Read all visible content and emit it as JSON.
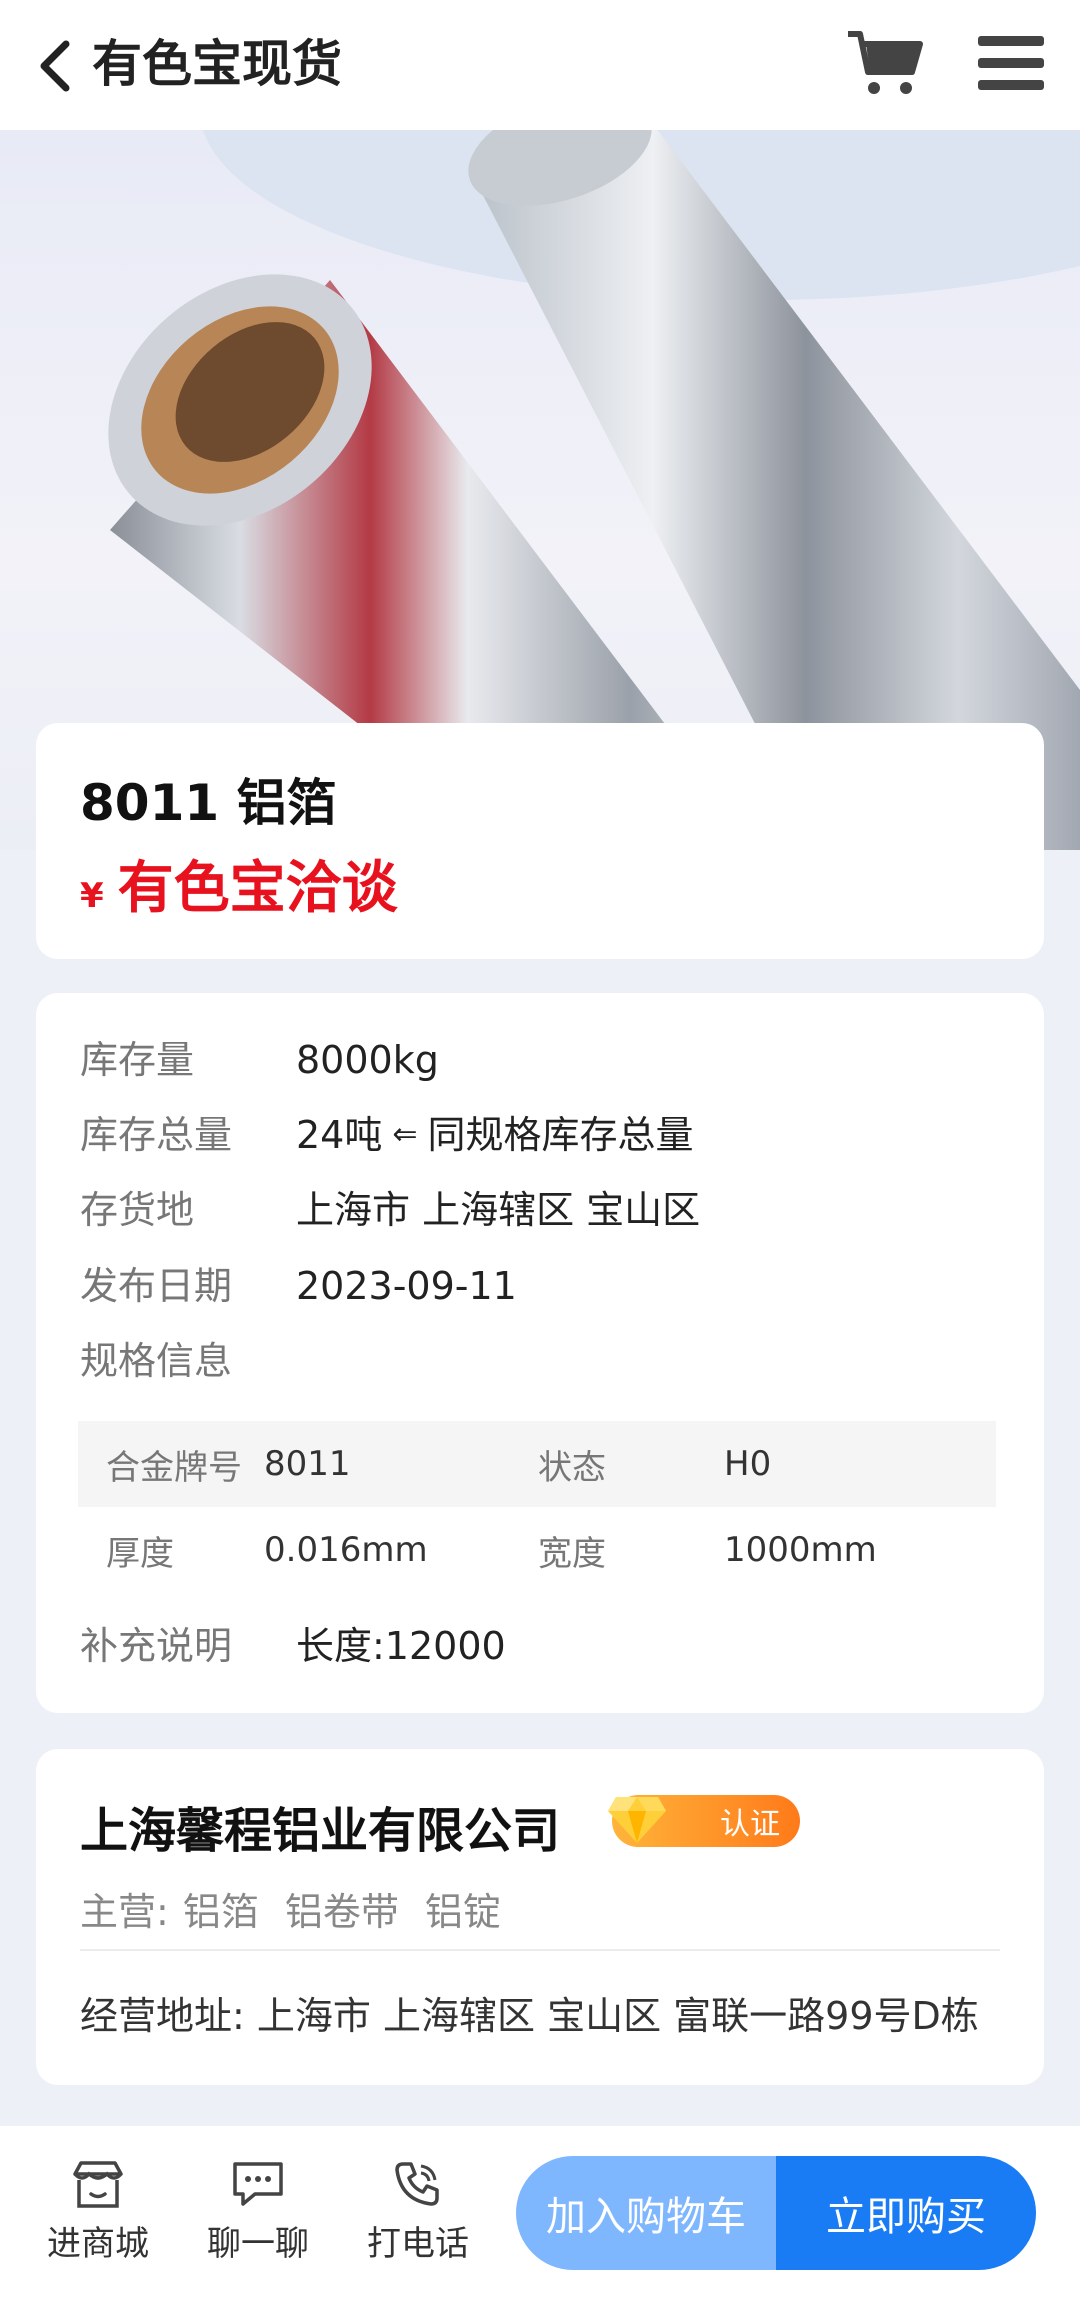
{
  "header": {
    "title": "有色宝现货",
    "back_icon": "chevron-left-icon",
    "cart_icon": "cart-icon",
    "menu_icon": "menu-icon"
  },
  "product": {
    "name": "8011 铝箔",
    "price_symbol": "¥",
    "price_text": "有色宝洽谈",
    "price_color": "#e8121f"
  },
  "info": {
    "rows": [
      {
        "label": "库存量",
        "value": "8000kg"
      },
      {
        "label": "库存总量",
        "value": "24吨",
        "arrow": "⇐",
        "note": "同规格库存总量"
      },
      {
        "label": "存货地",
        "value": "上海市 上海辖区 宝山区"
      },
      {
        "label": "发布日期",
        "value": "2023-09-11"
      },
      {
        "label": "规格信息",
        "value": ""
      }
    ],
    "spec": [
      {
        "k1": "合金牌号",
        "v1": "8011",
        "k2": "状态",
        "v2": "H0"
      },
      {
        "k1": "厚度",
        "v1": "0.016mm",
        "k2": "宽度",
        "v2": "1000mm"
      }
    ],
    "extra_label": "补充说明",
    "extra_value": "长度:12000"
  },
  "company": {
    "name": "上海馨程铝业有限公司",
    "cert_label": "认证",
    "main_label": "主营:",
    "main_items": [
      "铝箔",
      "铝卷带",
      "铝锭"
    ],
    "address_label": "经营地址:",
    "address": "上海市 上海辖区 宝山区 富联一路99号D栋"
  },
  "bottom_bar": {
    "shop_label": "进商城",
    "chat_label": "聊一聊",
    "call_label": "打电话",
    "add_cart_label": "加入购物车",
    "buy_label": "立即购买",
    "accent": "#1a7cf5",
    "accent_light": "#7fb7ff"
  }
}
